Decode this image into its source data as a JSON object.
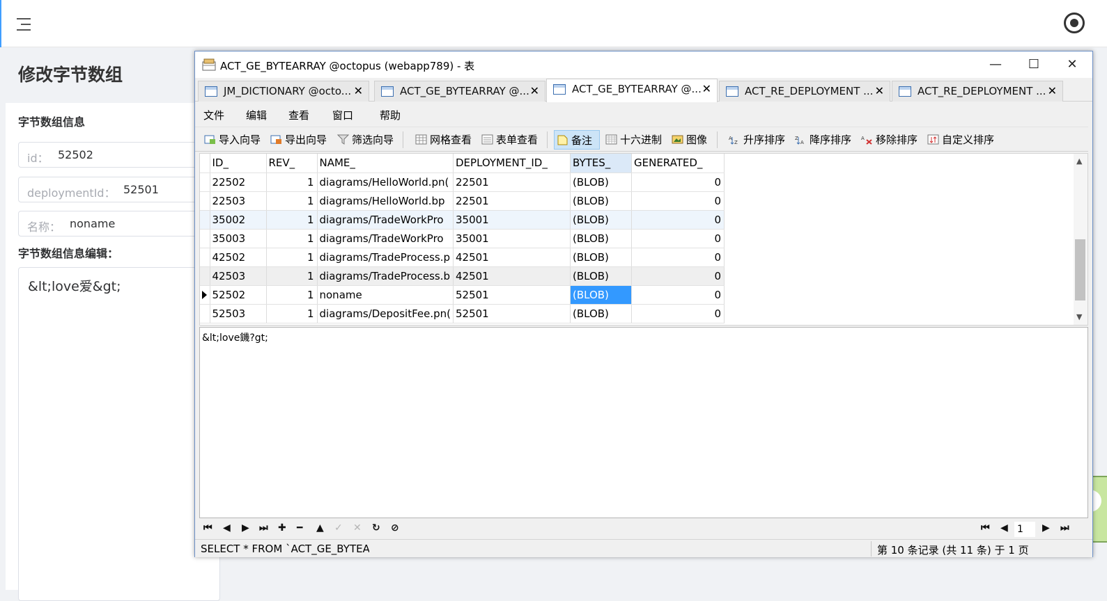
{
  "webapp": {
    "page_title": "修改字节数组",
    "section_title": "字节数组信息",
    "fields": [
      {
        "label": "id：",
        "value": "52502"
      },
      {
        "label": "deploymentId：",
        "value": "52501"
      },
      {
        "label": "名称：",
        "value": "noname"
      }
    ],
    "editor_title": "字节数组信息编辑：",
    "editor_content": "&lt;love爱&gt;"
  },
  "window": {
    "title": "ACT_GE_BYTEARRAY @octopus (webapp789) - 表",
    "minimize": "—",
    "maximize": "☐",
    "close": "✕"
  },
  "tabs": [
    {
      "label": "JM_DICTIONARY @octo...",
      "close": "✕"
    },
    {
      "label": "ACT_GE_BYTEARRAY @...",
      "close": "✕"
    },
    {
      "label": "ACT_GE_BYTEARRAY @...",
      "close": "✕"
    },
    {
      "label": "ACT_RE_DEPLOYMENT ...",
      "close": "✕"
    },
    {
      "label": "ACT_RE_DEPLOYMENT ...",
      "close": "✕"
    }
  ],
  "menu": [
    "文件",
    "编辑",
    "查看",
    "窗口",
    "帮助"
  ],
  "toolbar": {
    "import": "导入向导",
    "export": "导出向导",
    "filter": "筛选向导",
    "grid_view": "网格查看",
    "form_view": "表单查看",
    "memo": "备注",
    "hex": "十六进制",
    "image": "图像",
    "sort_asc": "升序排序",
    "sort_desc": "降序排序",
    "remove_sort": "移除排序",
    "custom_sort": "自定义排序"
  },
  "grid": {
    "columns": [
      "ID_",
      "REV_",
      "NAME_",
      "DEPLOYMENT_ID_",
      "BYTES_",
      "GENERATED_"
    ],
    "rows": [
      [
        "22502",
        "1",
        "diagrams/HelloWorld.pn(",
        "22501",
        "(BLOB)",
        "0"
      ],
      [
        "22503",
        "1",
        "diagrams/HelloWorld.bp",
        "22501",
        "(BLOB)",
        "0"
      ],
      [
        "35002",
        "1",
        "diagrams/TradeWorkPro",
        "35001",
        "(BLOB)",
        "0"
      ],
      [
        "35003",
        "1",
        "diagrams/TradeWorkPro",
        "35001",
        "(BLOB)",
        "0"
      ],
      [
        "42502",
        "1",
        "diagrams/TradeProcess.p",
        "42501",
        "(BLOB)",
        "0"
      ],
      [
        "42503",
        "1",
        "diagrams/TradeProcess.b",
        "42501",
        "(BLOB)",
        "0"
      ],
      [
        "52502",
        "1",
        "noname",
        "52501",
        "(BLOB)",
        "0"
      ],
      [
        "52503",
        "1",
        "diagrams/DepositFee.pn(",
        "52501",
        "(BLOB)",
        "0"
      ]
    ]
  },
  "blob_content": "&lt;love鐖?gt;",
  "navigation": {
    "page": "1"
  },
  "status": {
    "sql": "SELECT * FROM `ACT_GE_BYTEARI",
    "records": "第 10 条记录 (共 11 条) 于 1 页"
  }
}
